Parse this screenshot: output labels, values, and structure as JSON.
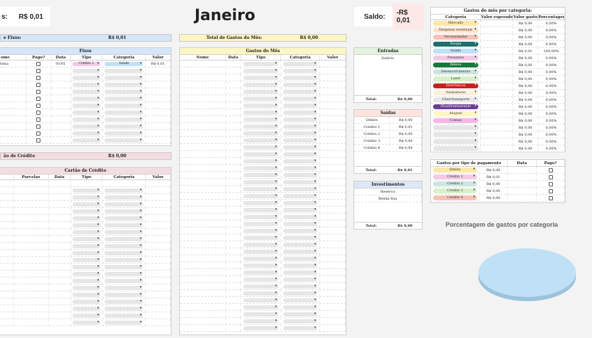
{
  "header": {
    "balance_left_label": "s:",
    "balance_left_value": "R$ 0,01",
    "month_title": "Janeiro",
    "saldo_label": "Saldo:",
    "saldo_value": "-R$ 0,01"
  },
  "summary_bars": {
    "fixos_label": "e Fixos:",
    "fixos_value": "R$ 0,01",
    "gastos_label": "Total de Gastos do Mês:",
    "gastos_value": "R$ 0,00",
    "cartao_label": "ão de Crédito",
    "cartao_value": "R$ 0,00"
  },
  "fixos": {
    "title": "Fixos",
    "columns": [
      "ome",
      "Pago?",
      "Data",
      "Tipo",
      "Categoria",
      "Valor"
    ],
    "first_row": {
      "nome": "lema",
      "data": "01/01",
      "tipo": "Crédito 1",
      "categoria": "Saúde",
      "valor": "R$ 0,01"
    }
  },
  "cartao": {
    "title": "Cartão de Crédito",
    "columns": [
      "",
      "Parcelas",
      "Data",
      "Tipo",
      "Categoria",
      "Valor"
    ]
  },
  "gastos_mes": {
    "title": "Gastos do Mês",
    "columns": [
      "Nome",
      "Data",
      "Tipo",
      "Categoria",
      "Valor"
    ]
  },
  "entradas": {
    "title": "Entradas",
    "items": [
      "Salário"
    ],
    "total_label": "Total:",
    "total_value": "R$ 0,00"
  },
  "saidas": {
    "title": "Saídas",
    "items": [
      {
        "name": "Débito",
        "value": "R$ 0,00"
      },
      {
        "name": "Crédito 1",
        "value": "R$ 0,01"
      },
      {
        "name": "Crédito 2",
        "value": "R$ 0,00"
      },
      {
        "name": "Crédito 3",
        "value": "R$ 0,00"
      },
      {
        "name": "Crédito 4",
        "value": "R$ 0,00"
      }
    ],
    "total_label": "Total:",
    "total_value": "R$ 0,01"
  },
  "investimentos": {
    "title": "Investimentos",
    "items": [
      "Reserva",
      "Renda fixa"
    ],
    "total_label": "Total:",
    "total_value": "R$ 0,00"
  },
  "categorias": {
    "title": "Gastos do mês por categoria:",
    "columns": [
      "Categoria",
      "Valor esperado",
      "Valor gasto",
      "Porcentagem"
    ],
    "rows": [
      {
        "name": "Mercado",
        "color": "#fbe8a6",
        "gasto": "R$ 0,00",
        "pct": "0,00%"
      },
      {
        "name": "Despesas eventuais",
        "color": "#fde2c9",
        "gasto": "R$ 0,00",
        "pct": "0,00%"
      },
      {
        "name": "Necessidades",
        "color": "#f6c2b8",
        "gasto": "R$ 0,00",
        "pct": "0,00%"
      },
      {
        "name": "Roupa",
        "color": "#1f6f6a",
        "gasto": "R$ 0,00",
        "pct": "0,00%"
      },
      {
        "name": "Saúde",
        "color": "#bfe0f5",
        "gasto": "R$ 0,01",
        "pct": "100,00%"
      },
      {
        "name": "Presentes",
        "color": "#f3c9e6",
        "gasto": "R$ 0,00",
        "pct": "0,00%"
      },
      {
        "name": "Beleza",
        "color": "#177a3d",
        "gasto": "R$ 0,00",
        "pct": "0,00%"
      },
      {
        "name": "Desenvolvimento",
        "color": "#cce5e0",
        "gasto": "R$ 0,00",
        "pct": "0,00%"
      },
      {
        "name": "Lazer",
        "color": "#d9f0c8",
        "gasto": "R$ 0,00",
        "pct": "0,00%"
      },
      {
        "name": "Eletrônicos",
        "color": "#c8211c",
        "gasto": "R$ 0,00",
        "pct": "0,00%"
      },
      {
        "name": "Assinaturas",
        "color": "#fff0d9",
        "gasto": "R$ 0,00",
        "pct": "0,00%"
      },
      {
        "name": "Uber/transporte",
        "color": "#e8e8e8",
        "gasto": "R$ 0,00",
        "pct": "0,00%"
      },
      {
        "name": "iFood/restaurante",
        "color": "#6b3d99",
        "gasto": "R$ 0,00",
        "pct": "0,00%"
      },
      {
        "name": "Aluguel",
        "color": "#fff7c2",
        "gasto": "R$ 0,00",
        "pct": "0,00%"
      },
      {
        "name": "Contas",
        "color": "#f5b8e6",
        "gasto": "R$ 0,00",
        "pct": "0,00%"
      },
      {
        "name": "",
        "color": "#e6e6e6",
        "gasto": "R$ 0,00",
        "pct": "0,00%"
      },
      {
        "name": "",
        "color": "#e6e6e6",
        "gasto": "R$ 0,00",
        "pct": "0,00%"
      },
      {
        "name": "",
        "color": "#e6e6e6",
        "gasto": "R$ 0,00",
        "pct": "0,00%"
      },
      {
        "name": "",
        "color": "#e6e6e6",
        "gasto": "R$ 0,00",
        "pct": "0,00%"
      }
    ]
  },
  "pagamento": {
    "title": "Gastos por tipo de pagamento",
    "columns": [
      "Gastos por tipo de pagamento",
      "Data",
      "Pago?"
    ],
    "rows": [
      {
        "name": "Débito",
        "color": "#fbe8a6",
        "value": "R$ 0,00"
      },
      {
        "name": "Crédito 1",
        "color": "#f3c9e6",
        "value": "R$ 0,01"
      },
      {
        "name": "Crédito 2",
        "color": "#cce5e0",
        "value": "R$ 0,00"
      },
      {
        "name": "Crédito 3",
        "color": "#d9f0c8",
        "value": "R$ 0,00"
      },
      {
        "name": "Crédito 4",
        "color": "#f6c2b8",
        "value": "R$ 0,00"
      }
    ]
  },
  "chart_data": {
    "type": "pie",
    "title": "Porcentagem de gastos por categoria",
    "categories": [
      "Saúde"
    ],
    "values": [
      100
    ],
    "colors": [
      "#bfe0f5"
    ]
  },
  "colors": {
    "fixos_header": "#d5e6f7",
    "gastos_header": "#fdf5c4",
    "entradas_header": "#e3f3df",
    "saidas_header": "#fde5de",
    "investimentos_header": "#dde8f7",
    "cartao_header": "#f3dde1",
    "saldo_bg": "#fde8e8"
  }
}
